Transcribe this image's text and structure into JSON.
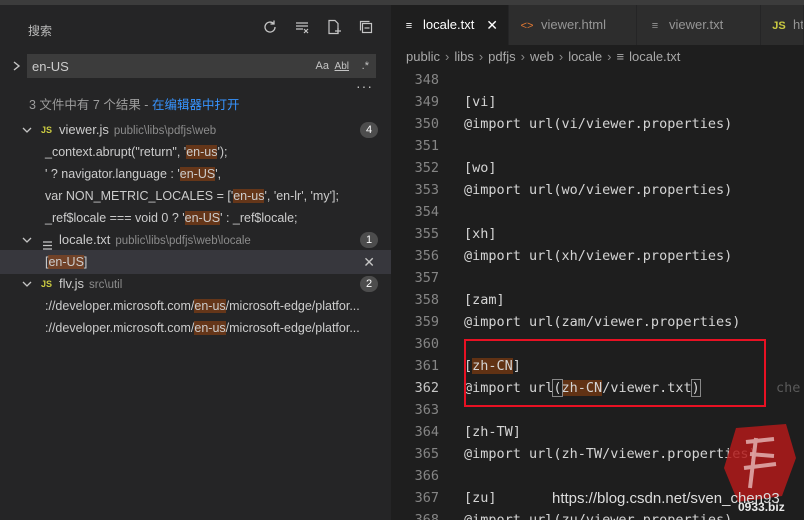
{
  "colors": {
    "accent_link": "#3794ff",
    "match_highlight": "#ea5c00",
    "redbox": "#e81123"
  },
  "sidebar": {
    "title": "搜索",
    "actions": [
      "refresh-icon",
      "clear-results-icon",
      "new-search-editor-icon",
      "collapse-all-icon"
    ],
    "search_value": "en-US",
    "options": {
      "match_case": "Aa",
      "whole_word": "Abl",
      "regex": ".*"
    },
    "more": "···",
    "summary_text": "3 文件中有 7 个结果 - ",
    "summary_link": "在编辑器中打开",
    "results": [
      {
        "file": "viewer.js",
        "path": "public\\libs\\pdfjs\\web",
        "count": "4",
        "icon": "JS",
        "matches": [
          {
            "pre": "_context.abrupt(\"return\", '",
            "hit": "en-us",
            "post": "');"
          },
          {
            "pre": "' ? navigator.language : '",
            "hit": "en-US",
            "post": "',"
          },
          {
            "pre": "var NON_METRIC_LOCALES = ['",
            "hit": "en-us",
            "post": "', 'en-lr', 'my'];"
          },
          {
            "pre": "_ref$locale === void 0 ? '",
            "hit": "en-US",
            "post": "' : _ref$locale;"
          }
        ]
      },
      {
        "file": "locale.txt",
        "path": "public\\libs\\pdfjs\\web\\locale",
        "count": "1",
        "icon": "txt",
        "matches": [
          {
            "pre": "[",
            "hit": "en-US",
            "post": "]",
            "close": "✕"
          }
        ]
      },
      {
        "file": "flv.js",
        "path": "src\\util",
        "count": "2",
        "icon": "JS",
        "matches": [
          {
            "pre": "://developer.microsoft.com/",
            "hit": "en-us",
            "post": "/microsoft-edge/platfor..."
          },
          {
            "pre": "://developer.microsoft.com/",
            "hit": "en-us",
            "post": "/microsoft-edge/platfor..."
          }
        ]
      }
    ]
  },
  "editor": {
    "tabs": [
      {
        "label": "locale.txt",
        "icon": "≡",
        "close": "✕"
      },
      {
        "label": "viewer.html",
        "icon": "<>"
      },
      {
        "label": "viewer.txt",
        "icon": "≡"
      },
      {
        "label": "htt",
        "icon": "JS"
      }
    ],
    "breadcrumb": [
      "public",
      "libs",
      "pdfjs",
      "web",
      "locale",
      "locale.txt"
    ],
    "lines": [
      {
        "n": "348",
        "text": ""
      },
      {
        "n": "349",
        "text": "[vi]"
      },
      {
        "n": "350",
        "text": "@import url(vi/viewer.properties)"
      },
      {
        "n": "351",
        "text": ""
      },
      {
        "n": "352",
        "text": "[wo]"
      },
      {
        "n": "353",
        "text": "@import url(wo/viewer.properties)"
      },
      {
        "n": "354",
        "text": ""
      },
      {
        "n": "355",
        "text": "[xh]"
      },
      {
        "n": "356",
        "text": "@import url(xh/viewer.properties)"
      },
      {
        "n": "357",
        "text": ""
      },
      {
        "n": "358",
        "text": "[zam]"
      },
      {
        "n": "359",
        "text": "@import url(zam/viewer.properties)"
      },
      {
        "n": "360",
        "text": ""
      },
      {
        "n": "361",
        "text": "[zh-CN]"
      },
      {
        "n": "362",
        "text": "@import url(zh-CN/viewer.txt)"
      },
      {
        "n": "363",
        "text": ""
      },
      {
        "n": "364",
        "text": "[zh-TW]"
      },
      {
        "n": "365",
        "text": "@import url(zh-TW/viewer.properties)"
      },
      {
        "n": "366",
        "text": ""
      },
      {
        "n": "367",
        "text": "[zu]"
      },
      {
        "n": "368",
        "text": "@import url(zu/viewer.properties)"
      }
    ],
    "ghost_text": "che",
    "line361": {
      "pre": "[",
      "hit": "zh-CN",
      "post": "]"
    },
    "line362": {
      "pre": "@import url",
      "open": "(",
      "hit": "zh-CN",
      "mid": "/viewer.txt",
      "close": ")"
    }
  },
  "watermark": "https://blog.csdn.net/sven_chen93",
  "seal_text": "0933.biz"
}
